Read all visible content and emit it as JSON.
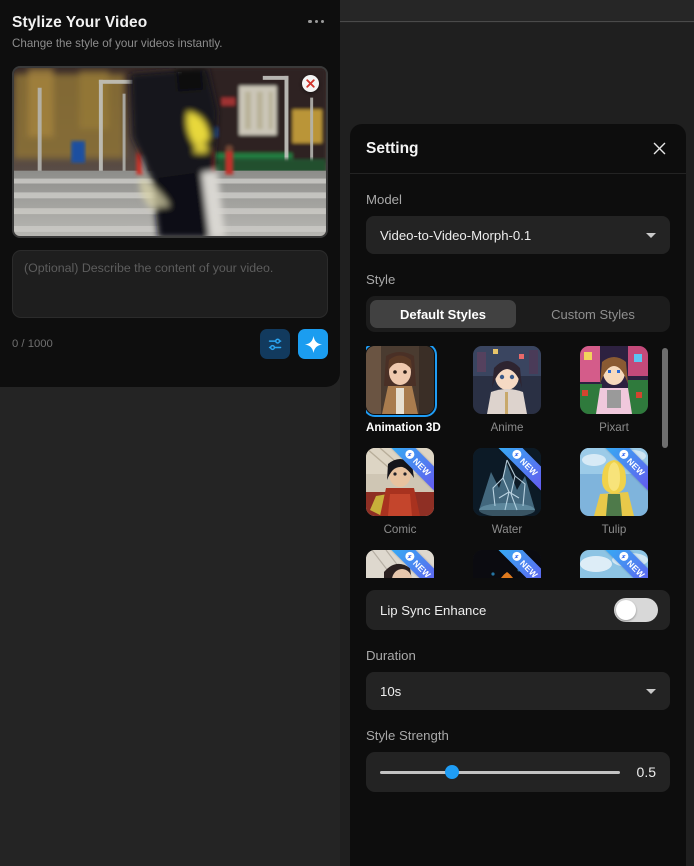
{
  "left_panel": {
    "title": "Stylize Your Video",
    "subtitle": "Change the style of your videos instantly.",
    "menu_icon": "kebab-menu-icon",
    "video": {
      "remove_icon": "close-circle-icon",
      "alt": "city street video preview"
    },
    "prompt": {
      "value": "",
      "placeholder": "(Optional) Describe the content of your video."
    },
    "counter": "0 / 1000",
    "actions": {
      "settings_icon": "sliders-icon",
      "generate_icon": "sparkle-icon"
    }
  },
  "setting": {
    "title": "Setting",
    "close_icon": "close-icon",
    "model": {
      "label": "Model",
      "value": "Video-to-Video-Morph-0.1",
      "caret_icon": "chevron-down-icon"
    },
    "style": {
      "label": "Style",
      "tabs": [
        {
          "label": "Default Styles",
          "active": true
        },
        {
          "label": "Custom Styles",
          "active": false
        }
      ],
      "items": [
        {
          "name": "Animation 3D",
          "selected": true,
          "new": false,
          "art": "animation3d"
        },
        {
          "name": "Anime",
          "selected": false,
          "new": false,
          "art": "anime"
        },
        {
          "name": "Pixart",
          "selected": false,
          "new": false,
          "art": "pixart"
        },
        {
          "name": "Comic",
          "selected": false,
          "new": true,
          "art": "comic"
        },
        {
          "name": "Water",
          "selected": false,
          "new": true,
          "art": "water"
        },
        {
          "name": "Tulip",
          "selected": false,
          "new": true,
          "art": "tulip"
        },
        {
          "name": "",
          "selected": false,
          "new": true,
          "art": "row3a"
        },
        {
          "name": "",
          "selected": false,
          "new": true,
          "art": "row3b"
        },
        {
          "name": "",
          "selected": false,
          "new": true,
          "art": "row3c"
        }
      ],
      "badge_text": "NEW",
      "badge_icon": "lightning-badge-icon"
    },
    "lip_sync": {
      "label": "Lip Sync Enhance",
      "enabled": false
    },
    "duration": {
      "label": "Duration",
      "value": "10s",
      "caret_icon": "chevron-down-icon"
    },
    "style_strength": {
      "label": "Style Strength",
      "value": "0.5",
      "percent": 30,
      "min": 0,
      "max": 1
    }
  },
  "colors": {
    "accent_blue": "#1f9df5",
    "panel_bg": "#0d0d0d",
    "field_bg": "#232323",
    "app_bg": "#242424",
    "ribbon_start": "#2fb6f5",
    "ribbon_end": "#6b4ff0"
  }
}
